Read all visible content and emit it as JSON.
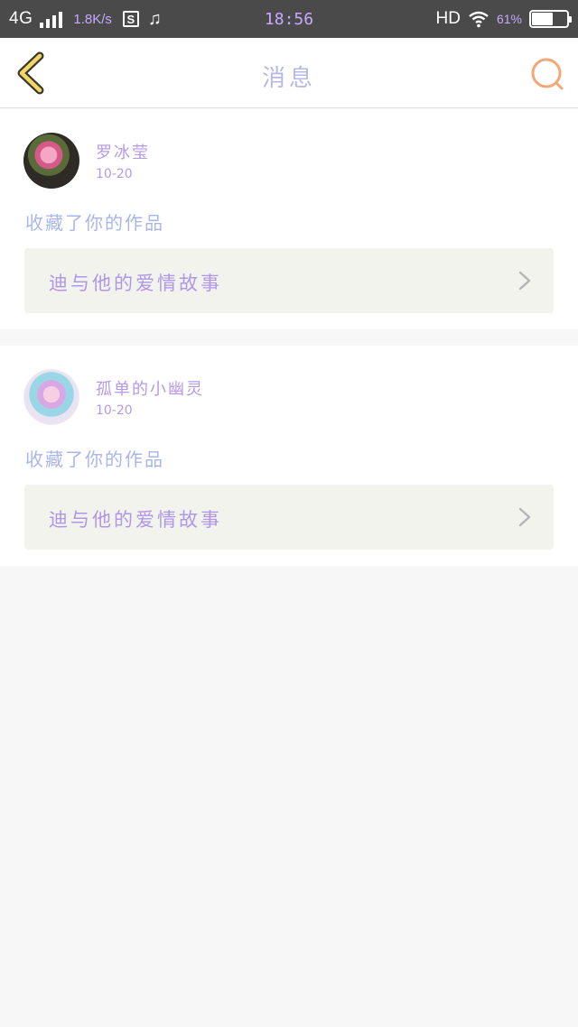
{
  "status_bar": {
    "network": "4G",
    "speed": "1.8K/s",
    "sync_label": "S",
    "music_icon": "music-note-icon",
    "time": "18:56",
    "hd": "HD",
    "battery_percent": "61%",
    "battery_level": 0.61
  },
  "header": {
    "title": "消息",
    "back_icon": "chevron-left-icon",
    "search_icon": "search-icon",
    "colors": {
      "back": "#f0d060",
      "title": "#b8b8e8",
      "search": "#f2a878"
    }
  },
  "messages": [
    {
      "username": "罗冰莹",
      "date": "10-20",
      "action": "收藏了你的作品",
      "work_title": "迪与他的爱情故事"
    },
    {
      "username": "孤单的小幽灵",
      "date": "10-20",
      "action": "收藏了你的作品",
      "work_title": "迪与他的爱情故事"
    }
  ]
}
